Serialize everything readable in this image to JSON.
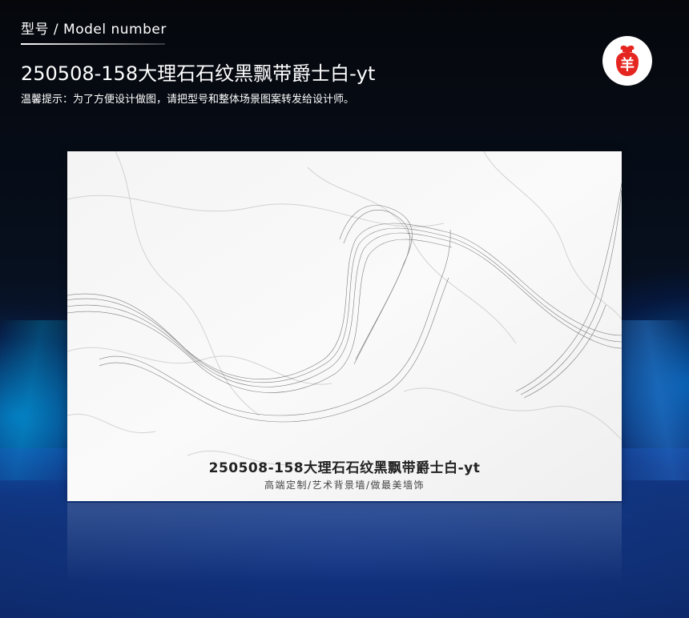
{
  "header": {
    "label": "型号 / Model number",
    "product_title": "250508-158大理石石纹黑飘带爵士白-yt",
    "tip": "温馨提示：为了方便设计做图，请把型号和整体场景图案转发给设计师。"
  },
  "logo": {
    "icon": "sheep-bag-logo-icon",
    "glyph": "羊",
    "color": "#e52520"
  },
  "panel": {
    "title": "250508-158大理石石纹黑飘带爵士白-yt",
    "tagline": "高端定制/艺术背景墙/做最美墙饰"
  },
  "colors": {
    "accent_red": "#e52520",
    "background_blue": "#0e2c66"
  }
}
